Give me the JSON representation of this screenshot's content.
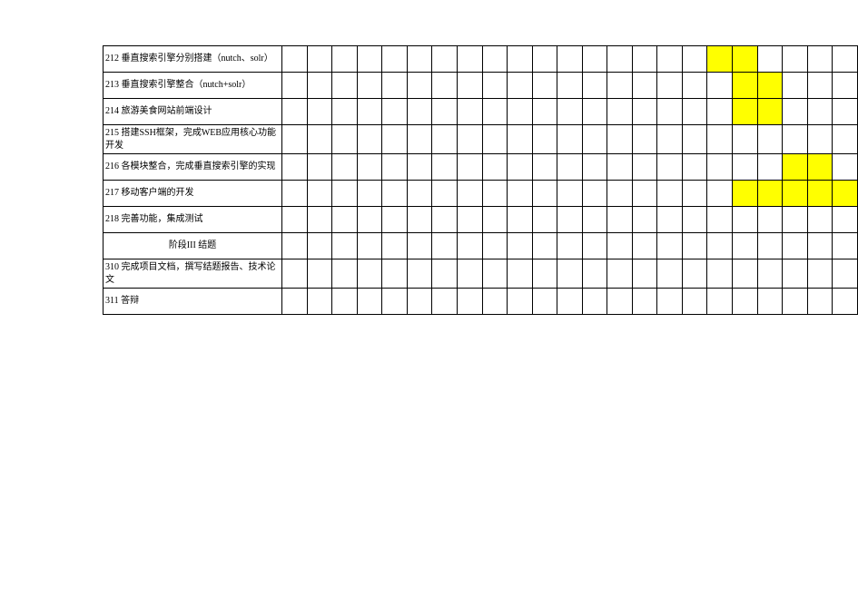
{
  "chart_data": {
    "type": "table",
    "title": "",
    "columns_count": 23,
    "column_indices": [
      1,
      2,
      3,
      4,
      5,
      6,
      7,
      8,
      9,
      10,
      11,
      12,
      13,
      14,
      15,
      16,
      17,
      18,
      19,
      20,
      21,
      22,
      23
    ],
    "rows": [
      {
        "id": "212",
        "label": "212 垂直搜索引擎分别搭建（nutch、solr）",
        "highlight": [
          18,
          19
        ]
      },
      {
        "id": "213",
        "label": "213 垂直搜索引擎整合（nutch+solr）",
        "highlight": [
          19,
          20
        ]
      },
      {
        "id": "214",
        "label": "214 旅游美食网站前端设计",
        "highlight": [
          19,
          20
        ]
      },
      {
        "id": "215",
        "label": "215 搭建SSH框架，完成WEB应用核心功能开发",
        "highlight": []
      },
      {
        "id": "216",
        "label": "216 各模块整合，完成垂直搜索引擎的实现",
        "highlight": [
          21,
          22
        ]
      },
      {
        "id": "217",
        "label": "217 移动客户端的开发",
        "highlight": [
          19,
          20,
          21,
          22,
          23
        ]
      },
      {
        "id": "218",
        "label": "218 完善功能，集成测试",
        "highlight": []
      },
      {
        "id": "phase3",
        "label": "阶段III 结题",
        "center": true,
        "highlight": []
      },
      {
        "id": "310",
        "label": "310 完成项目文档，撰写结题报告、技术论文",
        "highlight": []
      },
      {
        "id": "311",
        "label": "311 答辩",
        "highlight": []
      }
    ],
    "xlabel": "",
    "ylabel": ""
  },
  "colors": {
    "highlight": "#ffff00"
  }
}
